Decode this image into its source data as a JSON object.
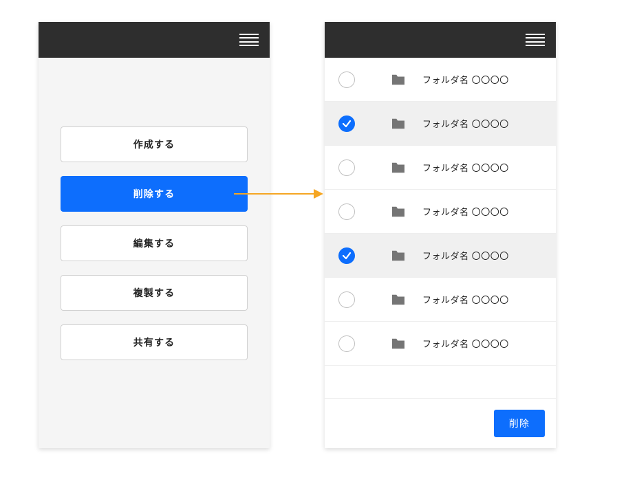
{
  "colors": {
    "primary": "#0d6efd",
    "header": "#2e2e2e",
    "arrow": "#f5a623",
    "folder": "#757575"
  },
  "left": {
    "menu": [
      {
        "label": "作成する",
        "primary": false
      },
      {
        "label": "削除する",
        "primary": true
      },
      {
        "label": "編集する",
        "primary": false
      },
      {
        "label": "複製する",
        "primary": false
      },
      {
        "label": "共有する",
        "primary": false
      }
    ]
  },
  "right": {
    "items": [
      {
        "label": "フォルダ名 〇〇〇〇",
        "checked": false
      },
      {
        "label": "フォルダ名 〇〇〇〇",
        "checked": true
      },
      {
        "label": "フォルダ名 〇〇〇〇",
        "checked": false
      },
      {
        "label": "フォルダ名 〇〇〇〇",
        "checked": false
      },
      {
        "label": "フォルダ名 〇〇〇〇",
        "checked": true
      },
      {
        "label": "フォルダ名 〇〇〇〇",
        "checked": false
      },
      {
        "label": "フォルダ名 〇〇〇〇",
        "checked": false
      }
    ],
    "delete_label": "削除"
  }
}
